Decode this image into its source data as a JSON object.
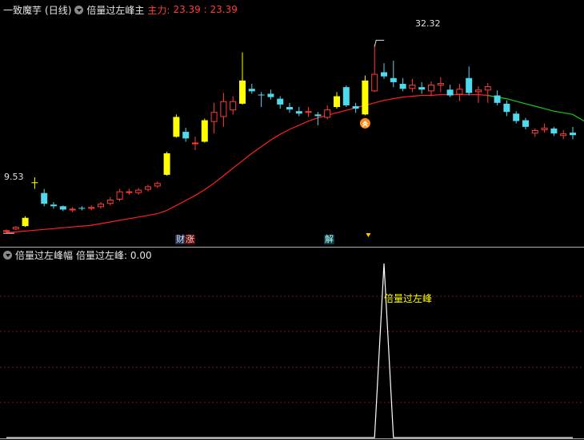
{
  "header": {
    "title": "一致魔芋",
    "period": "(日线)",
    "indicator": "倍量过左峰主",
    "main_label": "主力:",
    "main_value": "23.39 : 23.39"
  },
  "sub_header": {
    "indicator": "倍量过左峰幅",
    "value_text": "倍量过左峰: 0.00"
  },
  "badges": {
    "cai": "财",
    "zhang": "涨",
    "jie": "解"
  },
  "colors": {
    "up": "#ff3b3b",
    "down": "#4fd9ec",
    "signal": "#ffff00",
    "ma_rise": "#ff2020",
    "ma_fall": "#19c919",
    "grid": "#7a1a1a"
  },
  "chart_data": [
    {
      "type": "candlestick",
      "title": "",
      "annotations": {
        "low_label": "9.53",
        "high_label": "32.32"
      },
      "ylim": [
        8,
        36
      ],
      "candles": [
        {
          "o": 9.7,
          "h": 10.0,
          "l": 9.6,
          "c": 9.9,
          "s": "up"
        },
        {
          "o": 10.0,
          "h": 10.4,
          "l": 9.9,
          "c": 10.3,
          "s": "up"
        },
        {
          "o": 10.4,
          "h": 11.6,
          "l": 10.3,
          "c": 11.4,
          "s": "signal"
        },
        {
          "o": 15.6,
          "h": 16.3,
          "l": 14.9,
          "c": 15.7,
          "s": "signal"
        },
        {
          "o": 14.4,
          "h": 14.9,
          "l": 12.8,
          "c": 13.1,
          "s": "down"
        },
        {
          "o": 13.0,
          "h": 13.3,
          "l": 12.5,
          "c": 12.8,
          "s": "down"
        },
        {
          "o": 12.8,
          "h": 12.9,
          "l": 12.2,
          "c": 12.4,
          "s": "down"
        },
        {
          "o": 12.3,
          "h": 12.7,
          "l": 12.1,
          "c": 12.5,
          "s": "up"
        },
        {
          "o": 12.5,
          "h": 12.8,
          "l": 12.3,
          "c": 12.6,
          "s": "down"
        },
        {
          "o": 12.5,
          "h": 12.9,
          "l": 12.3,
          "c": 12.7,
          "s": "up"
        },
        {
          "o": 12.7,
          "h": 13.3,
          "l": 12.5,
          "c": 13.1,
          "s": "up"
        },
        {
          "o": 13.1,
          "h": 13.9,
          "l": 12.9,
          "c": 13.6,
          "s": "up"
        },
        {
          "o": 13.6,
          "h": 14.9,
          "l": 13.4,
          "c": 14.6,
          "s": "up"
        },
        {
          "o": 14.6,
          "h": 14.9,
          "l": 14.2,
          "c": 14.6,
          "s": "up"
        },
        {
          "o": 14.4,
          "h": 15.0,
          "l": 14.2,
          "c": 14.8,
          "s": "up"
        },
        {
          "o": 14.8,
          "h": 15.4,
          "l": 14.6,
          "c": 15.2,
          "s": "up"
        },
        {
          "o": 15.2,
          "h": 15.8,
          "l": 15.0,
          "c": 15.6,
          "s": "up"
        },
        {
          "o": 16.6,
          "h": 19.4,
          "l": 16.5,
          "c": 19.2,
          "s": "signal"
        },
        {
          "o": 21.2,
          "h": 23.9,
          "l": 21.1,
          "c": 23.6,
          "s": "signal"
        },
        {
          "o": 21.8,
          "h": 22.3,
          "l": 20.6,
          "c": 21.0,
          "s": "down"
        },
        {
          "o": 20.4,
          "h": 21.2,
          "l": 19.6,
          "c": 20.5,
          "s": "up"
        },
        {
          "o": 20.6,
          "h": 23.4,
          "l": 20.5,
          "c": 23.2,
          "s": "signal"
        },
        {
          "o": 23.0,
          "h": 25.3,
          "l": 21.6,
          "c": 24.2,
          "s": "up"
        },
        {
          "o": 23.6,
          "h": 26.5,
          "l": 22.4,
          "c": 25.5,
          "s": "up"
        },
        {
          "o": 24.4,
          "h": 26.1,
          "l": 23.9,
          "c": 25.5,
          "s": "up"
        },
        {
          "o": 25.2,
          "h": 31.4,
          "l": 25.1,
          "c": 28.0,
          "s": "signal"
        },
        {
          "o": 27.0,
          "h": 27.6,
          "l": 26.4,
          "c": 26.7,
          "s": "down"
        },
        {
          "o": 26.3,
          "h": 26.6,
          "l": 24.8,
          "c": 26.2,
          "s": "down"
        },
        {
          "o": 26.4,
          "h": 26.9,
          "l": 25.7,
          "c": 26.0,
          "s": "down"
        },
        {
          "o": 25.8,
          "h": 26.1,
          "l": 24.6,
          "c": 25.1,
          "s": "down"
        },
        {
          "o": 24.8,
          "h": 25.3,
          "l": 24.1,
          "c": 24.5,
          "s": "down"
        },
        {
          "o": 24.3,
          "h": 24.8,
          "l": 23.7,
          "c": 24.0,
          "s": "down"
        },
        {
          "o": 24.3,
          "h": 24.8,
          "l": 23.6,
          "c": 24.1,
          "s": "up"
        },
        {
          "o": 23.9,
          "h": 24.2,
          "l": 22.6,
          "c": 23.7,
          "s": "down"
        },
        {
          "o": 23.5,
          "h": 25.0,
          "l": 23.3,
          "c": 24.5,
          "s": "up"
        },
        {
          "o": 24.8,
          "h": 26.6,
          "l": 24.6,
          "c": 26.1,
          "s": "signal"
        },
        {
          "o": 27.2,
          "h": 27.4,
          "l": 24.8,
          "c": 25.0,
          "s": "down"
        },
        {
          "o": 24.9,
          "h": 25.3,
          "l": 24.1,
          "c": 24.6,
          "s": "down"
        },
        {
          "o": 23.9,
          "h": 28.6,
          "l": 23.8,
          "c": 28.0,
          "s": "signal"
        },
        {
          "o": 26.7,
          "h": 32.3,
          "l": 26.6,
          "c": 28.8,
          "s": "up"
        },
        {
          "o": 29.0,
          "h": 30.1,
          "l": 28.2,
          "c": 28.5,
          "s": "down"
        },
        {
          "o": 28.3,
          "h": 30.4,
          "l": 27.2,
          "c": 27.8,
          "s": "down"
        },
        {
          "o": 27.6,
          "h": 28.3,
          "l": 26.7,
          "c": 27.0,
          "s": "down"
        },
        {
          "o": 27.0,
          "h": 28.2,
          "l": 26.6,
          "c": 27.5,
          "s": "up"
        },
        {
          "o": 27.2,
          "h": 27.8,
          "l": 26.4,
          "c": 26.9,
          "s": "down"
        },
        {
          "o": 26.7,
          "h": 27.9,
          "l": 26.1,
          "c": 27.5,
          "s": "up"
        },
        {
          "o": 27.4,
          "h": 28.4,
          "l": 26.6,
          "c": 27.7,
          "s": "up"
        },
        {
          "o": 26.9,
          "h": 27.5,
          "l": 26.0,
          "c": 26.2,
          "s": "down"
        },
        {
          "o": 26.3,
          "h": 27.6,
          "l": 25.5,
          "c": 27.0,
          "s": "up"
        },
        {
          "o": 28.3,
          "h": 29.7,
          "l": 26.2,
          "c": 26.5,
          "s": "down"
        },
        {
          "o": 26.6,
          "h": 27.3,
          "l": 25.3,
          "c": 26.9,
          "s": "up"
        },
        {
          "o": 26.8,
          "h": 27.7,
          "l": 25.3,
          "c": 27.3,
          "s": "up"
        },
        {
          "o": 26.2,
          "h": 26.8,
          "l": 25.0,
          "c": 25.3,
          "s": "down"
        },
        {
          "o": 25.2,
          "h": 25.6,
          "l": 23.7,
          "c": 24.2,
          "s": "down"
        },
        {
          "o": 24.0,
          "h": 24.3,
          "l": 22.8,
          "c": 23.1,
          "s": "down"
        },
        {
          "o": 23.2,
          "h": 23.5,
          "l": 22.1,
          "c": 22.4,
          "s": "down"
        },
        {
          "o": 21.6,
          "h": 22.2,
          "l": 21.2,
          "c": 22.0,
          "s": "up"
        },
        {
          "o": 22.0,
          "h": 22.8,
          "l": 21.7,
          "c": 22.3,
          "s": "up"
        },
        {
          "o": 22.2,
          "h": 22.4,
          "l": 21.3,
          "c": 21.6,
          "s": "down"
        },
        {
          "o": 21.6,
          "h": 22.0,
          "l": 20.9,
          "c": 21.3,
          "s": "up"
        },
        {
          "o": 21.7,
          "h": 22.4,
          "l": 20.9,
          "c": 21.4,
          "s": "down"
        }
      ],
      "ma": [
        9.6,
        9.7,
        9.8,
        9.9,
        10.0,
        10.1,
        10.2,
        10.3,
        10.4,
        10.5,
        10.7,
        10.9,
        11.1,
        11.3,
        11.5,
        11.7,
        11.9,
        12.3,
        12.9,
        13.5,
        14.1,
        14.8,
        15.6,
        16.5,
        17.4,
        18.3,
        19.2,
        20.0,
        20.8,
        21.5,
        22.1,
        22.6,
        23.1,
        23.5,
        23.8,
        24.1,
        24.4,
        24.7,
        25.0,
        25.3,
        25.6,
        25.8,
        26.0,
        26.1,
        26.2,
        26.2,
        26.3,
        26.3,
        26.3,
        26.3,
        26.3,
        26.2,
        26.0,
        25.8,
        25.5,
        25.2,
        24.9,
        24.6,
        24.3,
        24.1,
        23.9
      ],
      "ma_turn_index": 51,
      "arrow_index": 38
    },
    {
      "type": "line",
      "title": "",
      "ylim": [
        0,
        1
      ],
      "values": [
        0,
        0,
        0,
        0,
        0,
        0,
        0,
        0,
        0,
        0,
        0,
        0,
        0,
        0,
        0,
        0,
        0,
        0,
        0,
        0,
        0,
        0,
        0,
        0,
        0,
        0,
        0,
        0,
        0,
        0,
        0,
        0,
        0,
        0,
        0,
        0,
        0,
        0,
        0,
        0,
        1,
        0,
        0,
        0,
        0,
        0,
        0,
        0,
        0,
        0,
        0,
        0,
        0,
        0,
        0,
        0,
        0,
        0,
        0,
        0,
        0
      ],
      "peak_label": "倍量过左峰"
    }
  ]
}
